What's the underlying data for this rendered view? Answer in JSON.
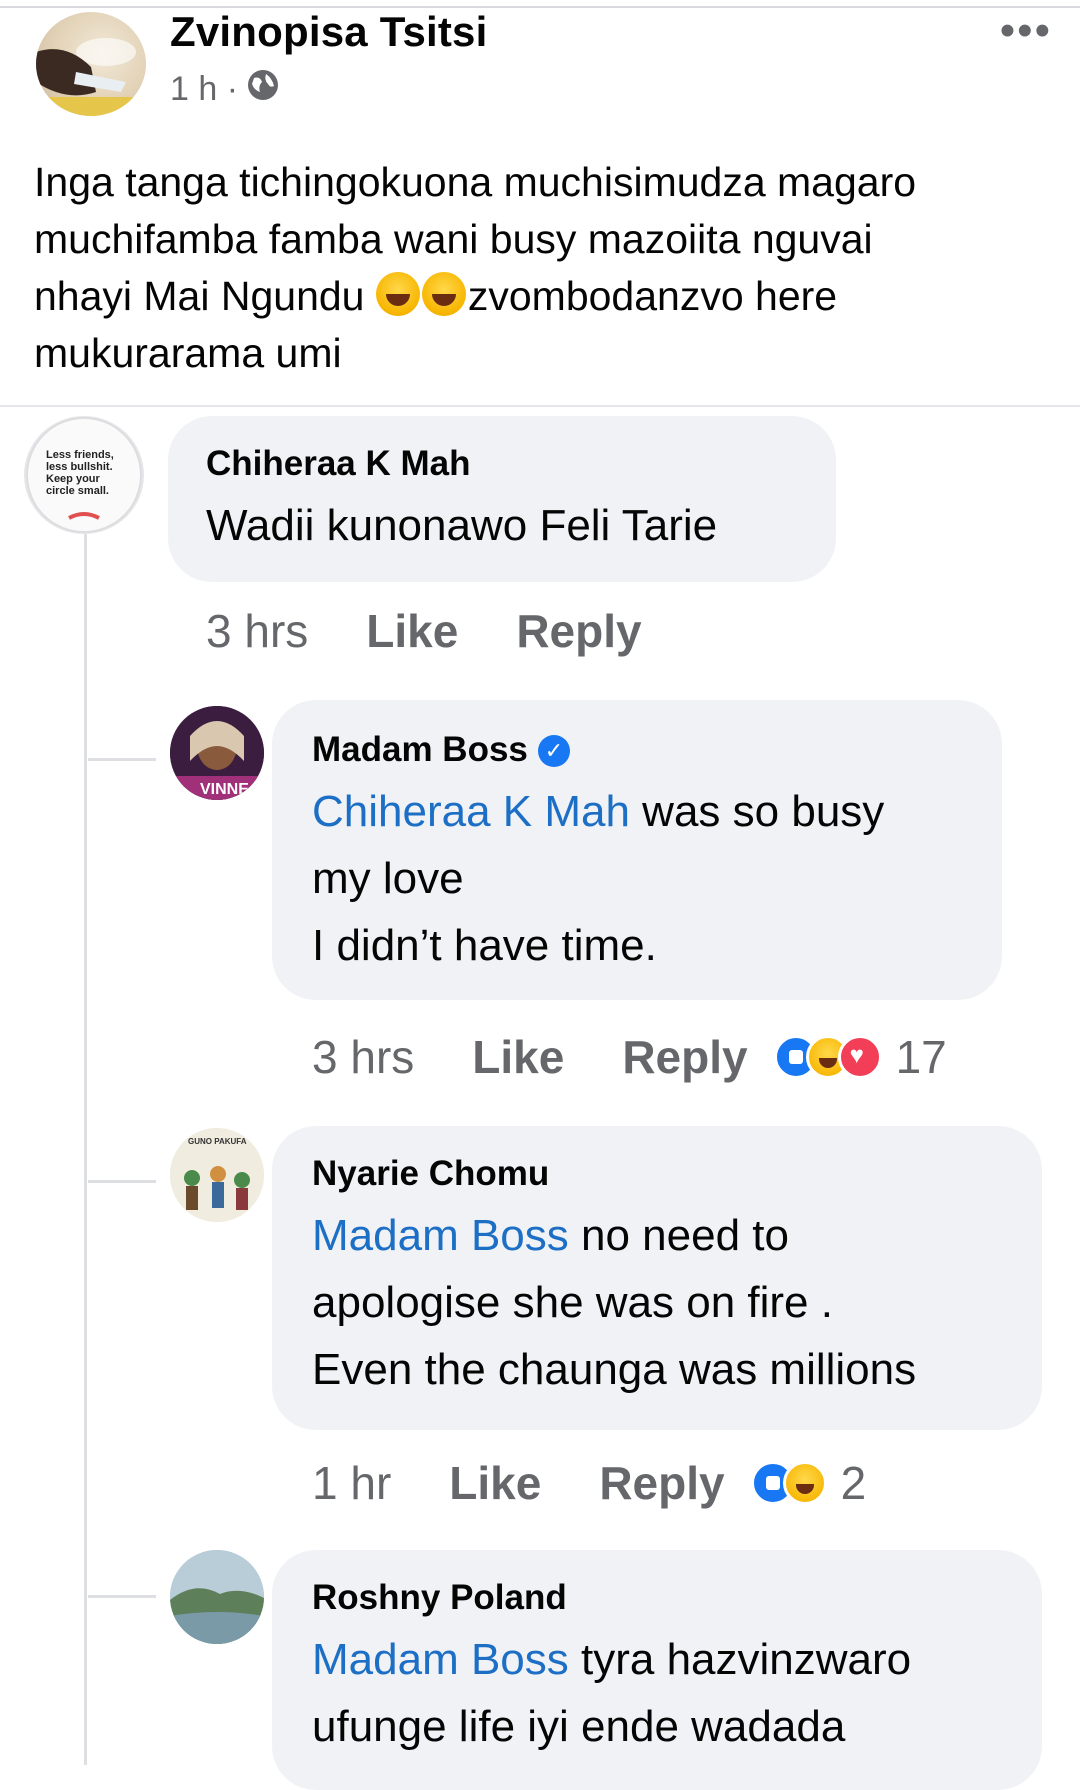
{
  "post": {
    "author": "Zvinopisa Tsitsi",
    "time": "1 h ·",
    "audience_icon": "globe-icon",
    "more_icon": "•••",
    "text_line1": "Inga tanga tichingokuona muchisimudza magaro",
    "text_line2": "muchifamba famba wani busy mazoiita nguvai",
    "text_line3a": "nhayi Mai Ngundu ",
    "text_line3b": "zvombodanzvo here",
    "text_line4": "mukurarama  umi"
  },
  "comments": [
    {
      "name": "Chiheraa K Mah",
      "text": "Wadii kunonawo Feli Tarie",
      "time": "3 hrs",
      "like": "Like",
      "reply": "Reply",
      "avatar_text": "Less friends, less bullshit. Keep your circle small."
    },
    {
      "name": "Madam Boss",
      "mention": "Chiheraa K Mah",
      "text1": " was so busy",
      "text2": "my love",
      "text3": "I didn’t have time.",
      "time": "3 hrs",
      "like": "Like",
      "reply": "Reply",
      "reaction_count": "17",
      "reactions": [
        "like",
        "haha",
        "love"
      ],
      "avatar_text": "VINNE"
    },
    {
      "name": "Nyarie Chomu",
      "mention": "Madam Boss",
      "text1": " no need to",
      "text2": "apologise she was on fire .",
      "text3": "Even the chaunga was millions",
      "time": "1 hr",
      "like": "Like",
      "reply": "Reply",
      "reaction_count": "2",
      "reactions": [
        "like",
        "haha"
      ],
      "avatar_text": "GUNO PAKUFA"
    },
    {
      "name": "Roshny Poland",
      "mention": "Madam Boss",
      "text1": " tyra hazvinzwaro",
      "text2": "ufunge life iyi ende wadada"
    }
  ],
  "colors": {
    "mention": "#1d6fc5",
    "bubble": "#f0f2f5",
    "meta": "#65676b",
    "like_reaction": "#1877f2",
    "love_reaction": "#f33e58"
  }
}
